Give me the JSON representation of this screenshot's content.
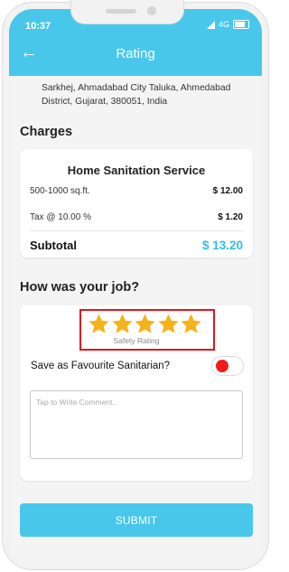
{
  "status_bar": {
    "time": "10:37",
    "network": "4G"
  },
  "header": {
    "title": "Rating",
    "back_icon": "arrow-left-icon"
  },
  "address": "Sarkhej, Ahmadabad City Taluka, Ahmedabad District, Gujarat, 380051, India",
  "charges": {
    "title": "Charges",
    "service_name": "Home Sanitation Service",
    "rows": [
      {
        "label": "500-1000 sq.ft.",
        "value": "$ 12.00"
      },
      {
        "label": "Tax @ 10.00 %",
        "value": "$ 1.20"
      }
    ],
    "subtotal_label": "Subtotal",
    "subtotal_value": "$ 13.20"
  },
  "feedback": {
    "title": "How was your job?",
    "rating": 5,
    "rating_max": 5,
    "rating_label": "Safety Rating",
    "favourite_label": "Save as Favourite Sanitarian?",
    "favourite_on": false,
    "comment_placeholder": "Tap to Write Comment..",
    "comment_value": ""
  },
  "submit_label": "SUBMIT",
  "colors": {
    "accent": "#49c7ea",
    "star": "#f6b21b",
    "highlight": "#e0161d",
    "toggle_knob": "#f21b1b"
  }
}
